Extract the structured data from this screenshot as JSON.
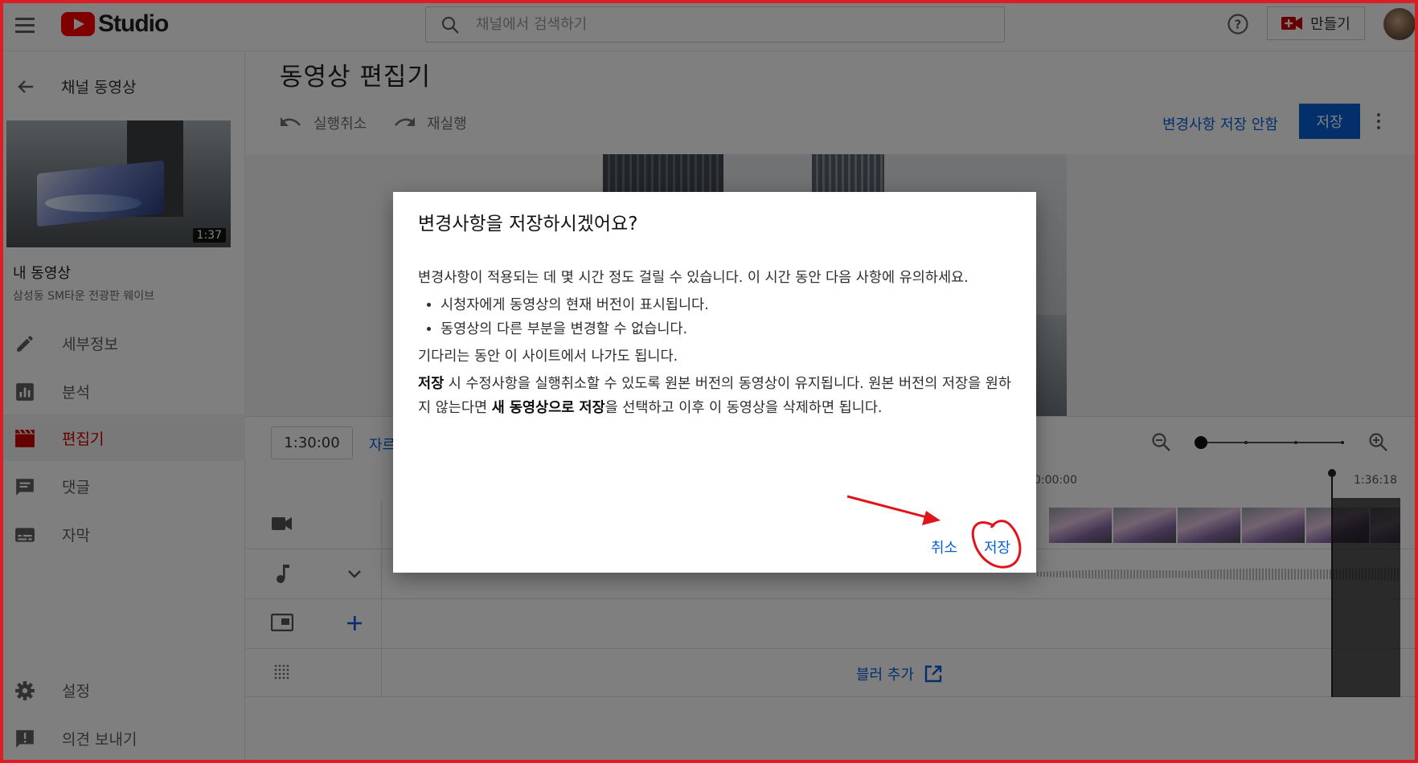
{
  "header": {
    "logo_text": "Studio",
    "search_placeholder": "채널에서 검색하기",
    "create_label": "만들기"
  },
  "sidebar": {
    "back_label": "채널 동영상",
    "thumbnail_duration": "1:37",
    "my_video_label": "내 동영상",
    "video_title": "삼성동 SM타운 전광판 웨이브",
    "items": [
      {
        "label": "세부정보",
        "icon": "pencil-icon",
        "active": false
      },
      {
        "label": "분석",
        "icon": "analytics-icon",
        "active": false
      },
      {
        "label": "편집기",
        "icon": "clapperboard-icon",
        "active": true
      },
      {
        "label": "댓글",
        "icon": "comment-icon",
        "active": false
      },
      {
        "label": "자막",
        "icon": "subtitles-icon",
        "active": false
      }
    ],
    "bottom_items": [
      {
        "label": "설정",
        "icon": "gear-icon"
      },
      {
        "label": "의견 보내기",
        "icon": "feedback-icon"
      }
    ]
  },
  "editor": {
    "title": "동영상 편집기",
    "undo_label": "실행취소",
    "redo_label": "재실행",
    "discard_label": "변경사항 저장 안함",
    "save_label": "저장",
    "timecode": "1:30:00",
    "cut_label": "자르",
    "timeline_start": "0:00:00",
    "timeline_end": "1:36:18",
    "add_blur_label": "블러 추가"
  },
  "dialog": {
    "title": "변경사항을 저장하시겠어요?",
    "intro": "변경사항이 적용되는 데 몇 시간 정도 걸릴 수 있습니다. 이 시간 동안 다음 사항에 유의하세요.",
    "bullets": [
      "시청자에게 동영상의 현재 버전이 표시됩니다.",
      "동영상의 다른 부분을 변경할 수 없습니다."
    ],
    "leave_note": "기다리는 동안 이 사이트에서 나가도 됩니다.",
    "note_bold_1": "저장",
    "note_text_1": " 시 수정사항을 실행취소할 수 있도록 원본 버전의 동영상이 유지됩니다. 원본 버전의 저장을 원하지 않는다면 ",
    "note_bold_2": "새 동영상으로 저장",
    "note_text_2": "을 선택하고 이후 이 동영상을 삭제하면 됩니다.",
    "cancel_label": "취소",
    "save_label": "저장"
  },
  "colors": {
    "accent": "#065fd4",
    "brand_red": "#ff0000",
    "annotation_red": "#e0151b"
  }
}
